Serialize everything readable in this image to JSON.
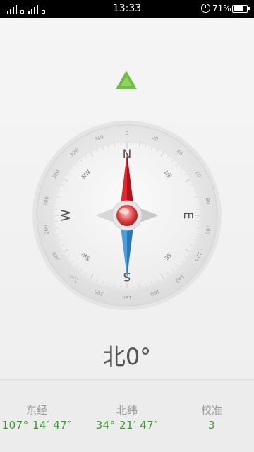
{
  "status_bar": {
    "time": "13:33",
    "battery_percent": "71%",
    "battery_level": 0.71
  },
  "compass": {
    "degree_labels": [
      "0",
      "20",
      "40",
      "60",
      "80",
      "100",
      "120",
      "140",
      "160",
      "180",
      "200",
      "220",
      "240",
      "260",
      "280",
      "300",
      "320",
      "340"
    ],
    "cardinals": {
      "N": "N",
      "E": "E",
      "S": "S",
      "W": "W"
    },
    "intercardinals": {
      "NE": "NE",
      "SE": "SE",
      "SW": "SW",
      "NW": "NW"
    },
    "heading_text": "北0°",
    "accent_color": "#6fbf45"
  },
  "footer": {
    "longitude_label": "东经",
    "longitude_value": "107°  14′  47″",
    "latitude_label": "北纬",
    "latitude_value": "34°  21′  47″",
    "calibration_label": "校准",
    "calibration_value": "3"
  }
}
